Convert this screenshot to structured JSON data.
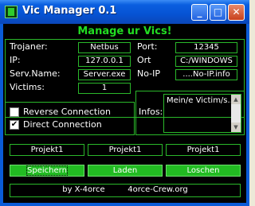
{
  "window": {
    "title": "Vic Manager 0.1",
    "minimize_label": "_",
    "maximize_label": "□",
    "close_label": "✕"
  },
  "heading": "Manage ur Vics!",
  "fields": {
    "trojaner_label": "Trojaner:",
    "trojaner_value": "Netbus",
    "ip_label": "IP:",
    "ip_value": "127.0.0.1",
    "serv_label": "Serv.Name:",
    "serv_value": "Server.exe",
    "victims_label": "Victims:",
    "victims_value": "1",
    "port_label": "Port:",
    "port_value": "12345",
    "ort_label": "Ort",
    "ort_value": "C:/WINDOWS",
    "noip_label": "No-IP",
    "noip_value": "....No-IP.info"
  },
  "options": {
    "reverse_label": "Reverse Connection",
    "reverse_checked": false,
    "direct_label": "Direct Connection",
    "direct_checked": true,
    "direct_mark": "✔"
  },
  "infos": {
    "label": "Infos:",
    "text": "Mein/e Victim/s....",
    "scroll_up": "▲",
    "scroll_down": "▼"
  },
  "projects": [
    "Projekt1",
    "Projekt1",
    "Projekt1"
  ],
  "actions": {
    "save": "Speichern",
    "load": "Laden",
    "delete": "Loschen"
  },
  "footer": {
    "by": "by X-4orce",
    "site": "4orce-Crew.org"
  },
  "colors": {
    "accent": "#22dd22",
    "border": "#2ab82a",
    "button": "#22bb22",
    "background": "#000000"
  }
}
